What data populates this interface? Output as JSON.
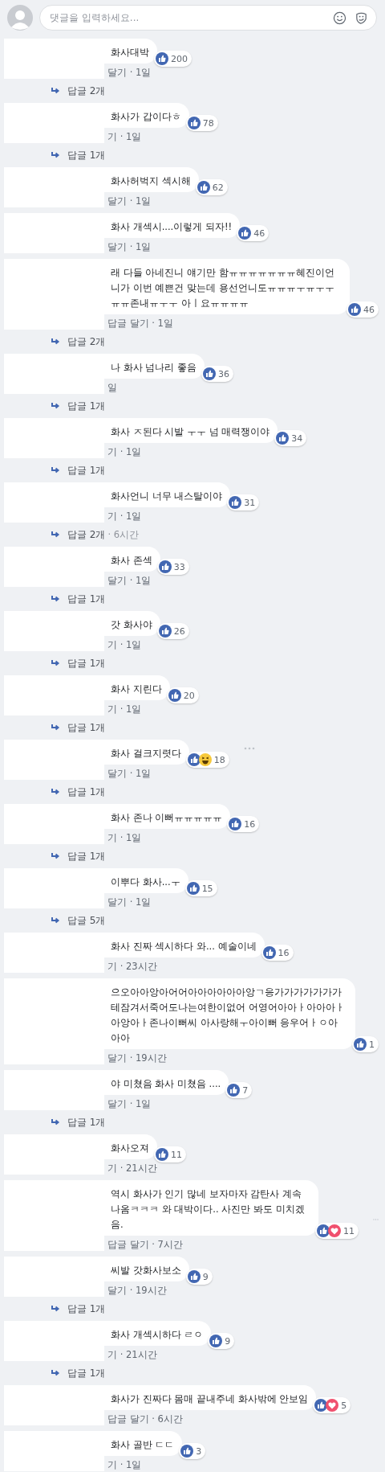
{
  "composer": {
    "placeholder": "댓글을 입력하세요..."
  },
  "comments": [
    {
      "text": "화사대박",
      "reactions": [
        {
          "kind": "like"
        }
      ],
      "count": "200",
      "more_menu": false,
      "meta": "달기 · 1일",
      "replies": {
        "label": "답글 2개"
      }
    },
    {
      "text": "화사가 갑이다ㅎ",
      "reactions": [
        {
          "kind": "like"
        }
      ],
      "count": "78",
      "more_menu": false,
      "meta": "기 · 1일",
      "replies": {
        "label": "답글 1개"
      }
    },
    {
      "text": "화사허벅지 섹시해",
      "reactions": [
        {
          "kind": "like"
        }
      ],
      "count": "62",
      "more_menu": false,
      "meta": "달기 · 1일"
    },
    {
      "text": "화사 개섹시....이렇게 되자!!",
      "reactions": [
        {
          "kind": "like"
        }
      ],
      "count": "46",
      "more_menu": false,
      "meta": "달기 · 1일"
    },
    {
      "text": "래 다들 아네진니 얘기만 함ㅠㅠㅠㅠㅠㅠㅠ혜진이언니가 이번 예쁜건 맞는데 용선언니도ㅠㅠㅠㅜㅠㅜㅜㅠㅠ존내ㅠㅜㅜ 아ㅣ요ㅠㅠㅠㅠ",
      "reactions": [
        {
          "kind": "like"
        }
      ],
      "count": "46",
      "more_menu": false,
      "meta": "답글 달기 · 1일",
      "replies": {
        "label": "답글 2개"
      }
    },
    {
      "text": "나 화사 넘나리 좋음",
      "reactions": [
        {
          "kind": "like"
        }
      ],
      "count": "36",
      "more_menu": false,
      "meta": "일",
      "replies": {
        "label": "답글 1개"
      }
    },
    {
      "text": "화사 ㅈ된다 시발 ㅜㅜ 넘 매력쟁이야",
      "reactions": [
        {
          "kind": "like"
        }
      ],
      "count": "34",
      "more_menu": false,
      "meta": "기 · 1일",
      "replies": {
        "label": "답글 1개"
      }
    },
    {
      "text": "화사언니 너무 내스탈이야",
      "reactions": [
        {
          "kind": "like"
        }
      ],
      "count": "31",
      "more_menu": false,
      "meta": "기 · 1일",
      "replies": {
        "label": "답글 2개",
        "time": "· 6시간"
      }
    },
    {
      "text": "화사 존섹",
      "reactions": [
        {
          "kind": "like"
        }
      ],
      "count": "33",
      "more_menu": false,
      "meta": "달기 · 1일",
      "replies": {
        "label": "답글 1개"
      }
    },
    {
      "text": "갓 화사야",
      "reactions": [
        {
          "kind": "like"
        }
      ],
      "count": "26",
      "more_menu": false,
      "meta": "기 · 1일",
      "replies": {
        "label": "답글 1개"
      }
    },
    {
      "text": "화사 지린다",
      "reactions": [
        {
          "kind": "like"
        }
      ],
      "count": "20",
      "more_menu": false,
      "meta": "기 · 1일",
      "replies": {
        "label": "답글 1개"
      }
    },
    {
      "text": "화사 걸크지렷다",
      "reactions": [
        {
          "kind": "like"
        },
        {
          "kind": "haha"
        }
      ],
      "count": "18",
      "more_menu": true,
      "meta": "달기 · 1일",
      "replies": {
        "label": "답글 1개"
      }
    },
    {
      "text": "화사 존나 이뻐ㅠㅠㅠㅠㅠ",
      "reactions": [
        {
          "kind": "like"
        }
      ],
      "count": "16",
      "more_menu": false,
      "meta": "기 · 1일",
      "replies": {
        "label": "답글 1개"
      }
    },
    {
      "text": "이뿌다 화사...ㅜ",
      "reactions": [
        {
          "kind": "like"
        }
      ],
      "count": "15",
      "more_menu": false,
      "meta": "달기 · 1일",
      "replies": {
        "label": "답글 5개"
      }
    },
    {
      "text": "화사 진짜 섹시하다 와... 예술이네",
      "reactions": [
        {
          "kind": "like"
        }
      ],
      "count": "16",
      "more_menu": false,
      "meta": "기 · 23시간"
    },
    {
      "text": "으오아아앙아어어아아아아아아앙ㄱ응가가가가가가가테잠겨서죽어도나는여한이없어 어영어아아ㅏ아아아ㅏ아앙아ㅏ존나이뻐씨 아사랑해ㅜ아이뻐 응우어ㅏㅇ아아아",
      "reactions": [
        {
          "kind": "like"
        }
      ],
      "count": "1",
      "more_menu": false,
      "meta": "달기 · 19시간"
    },
    {
      "text": "야 미쳤음 화사 미쳤음 ....",
      "reactions": [
        {
          "kind": "like"
        }
      ],
      "count": "7",
      "more_menu": false,
      "meta": "달기 · 1일",
      "replies": {
        "label": "답글 1개"
      }
    },
    {
      "text": "화사오져",
      "reactions": [
        {
          "kind": "like"
        }
      ],
      "count": "11",
      "more_menu": false,
      "meta": "기 · 21시간"
    },
    {
      "text": "역시 화사가 인기 많네 보자마자 감탄사 계속 나옴ㅋㅋㅋ 와 대박이다.. 사진만 봐도 미치겠음.",
      "reactions": [
        {
          "kind": "like"
        },
        {
          "kind": "love"
        }
      ],
      "count": "11",
      "more_menu": true,
      "meta": "답글 달기 · 7시간"
    },
    {
      "text": "씨발 갓화사보소",
      "reactions": [
        {
          "kind": "like"
        }
      ],
      "count": "9",
      "more_menu": false,
      "meta": "달기 · 19시간",
      "replies": {
        "label": "답글 1개"
      }
    },
    {
      "text": "화사 개섹시하다 ㄹㅇ",
      "reactions": [
        {
          "kind": "like"
        }
      ],
      "count": "9",
      "more_menu": false,
      "meta": "기 · 21시간",
      "replies": {
        "label": "답글 1개"
      }
    },
    {
      "text": "화사가 진짜다 몸매 끝내주네 화사밖에 안보임",
      "reactions": [
        {
          "kind": "like"
        },
        {
          "kind": "love"
        }
      ],
      "count": "5",
      "more_menu": false,
      "meta": "답글 달기 · 6시간"
    },
    {
      "text": "화사 골반 ㄷㄷ",
      "reactions": [
        {
          "kind": "like"
        }
      ],
      "count": "3",
      "more_menu": false,
      "meta": "기 · 1일"
    }
  ]
}
